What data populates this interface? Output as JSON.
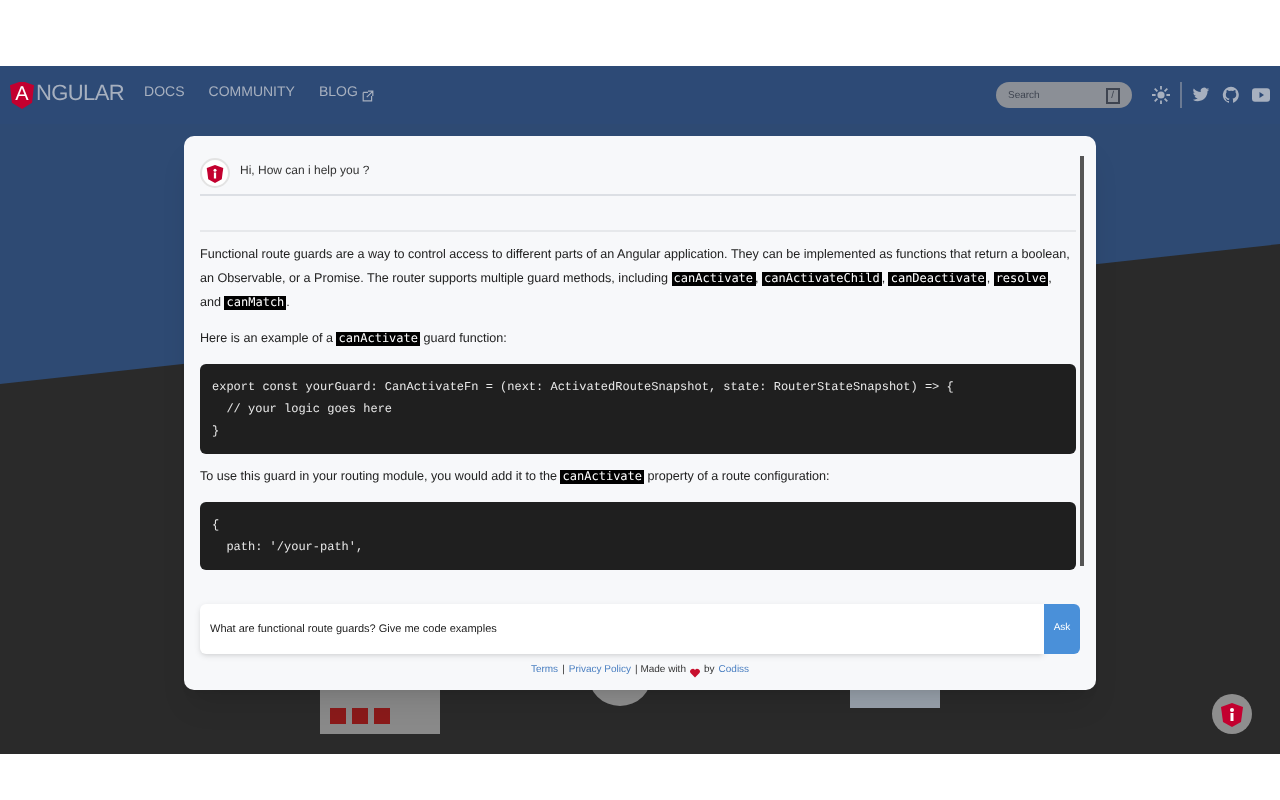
{
  "nav": {
    "logo_letter": "A",
    "logo_text": "NGULAR",
    "links": [
      {
        "label": "DOCS",
        "external": false
      },
      {
        "label": "COMMUNITY",
        "external": false
      },
      {
        "label": "BLOG",
        "external": true
      }
    ],
    "search": {
      "placeholder": "Search",
      "key": "/"
    }
  },
  "chat": {
    "greeting": "Hi, How can i help you ?",
    "answer": [
      {
        "kind": "paragraph",
        "parts": [
          {
            "kind": "text",
            "text": "Functional route guards are a way to control access to different parts of an Angular application. They can be implemented as functions that return a boolean, an Observable, or a Promise. The router supports multiple guard methods, including "
          },
          {
            "kind": "code",
            "text": "canActivate"
          },
          {
            "kind": "text",
            "text": ", "
          },
          {
            "kind": "code",
            "text": "canActivateChild"
          },
          {
            "kind": "text",
            "text": ", "
          },
          {
            "kind": "code",
            "text": "canDeactivate"
          },
          {
            "kind": "text",
            "text": ", "
          },
          {
            "kind": "code",
            "text": "resolve"
          },
          {
            "kind": "text",
            "text": ", and "
          },
          {
            "kind": "code",
            "text": "canMatch"
          },
          {
            "kind": "text",
            "text": "."
          }
        ]
      },
      {
        "kind": "paragraph",
        "parts": [
          {
            "kind": "text",
            "text": "Here is an example of a "
          },
          {
            "kind": "code",
            "text": "canActivate"
          },
          {
            "kind": "text",
            "text": " guard function:"
          }
        ]
      },
      {
        "kind": "code",
        "lines": [
          "export const yourGuard: CanActivateFn = (next: ActivatedRouteSnapshot, state: RouterStateSnapshot) => {",
          "  // your logic goes here",
          "}"
        ]
      },
      {
        "kind": "paragraph",
        "parts": [
          {
            "kind": "text",
            "text": "To use this guard in your routing module, you would add it to the "
          },
          {
            "kind": "code",
            "text": "canActivate"
          },
          {
            "kind": "text",
            "text": " property of a route configuration:"
          }
        ]
      },
      {
        "kind": "code",
        "lines": [
          "{",
          "  path: '/your-path',"
        ]
      }
    ],
    "input": {
      "value": "What are functional route guards? Give me code examples"
    },
    "ask": "Ask",
    "footer": [
      {
        "kind": "link",
        "text": "Terms"
      },
      {
        "kind": "text",
        "text": "|"
      },
      {
        "kind": "link",
        "text": "Privacy Policy"
      },
      {
        "kind": "text",
        "text": "| Made with"
      },
      {
        "kind": "heart"
      },
      {
        "kind": "text",
        "text": "by"
      },
      {
        "kind": "link",
        "text": "Codiss"
      }
    ]
  }
}
